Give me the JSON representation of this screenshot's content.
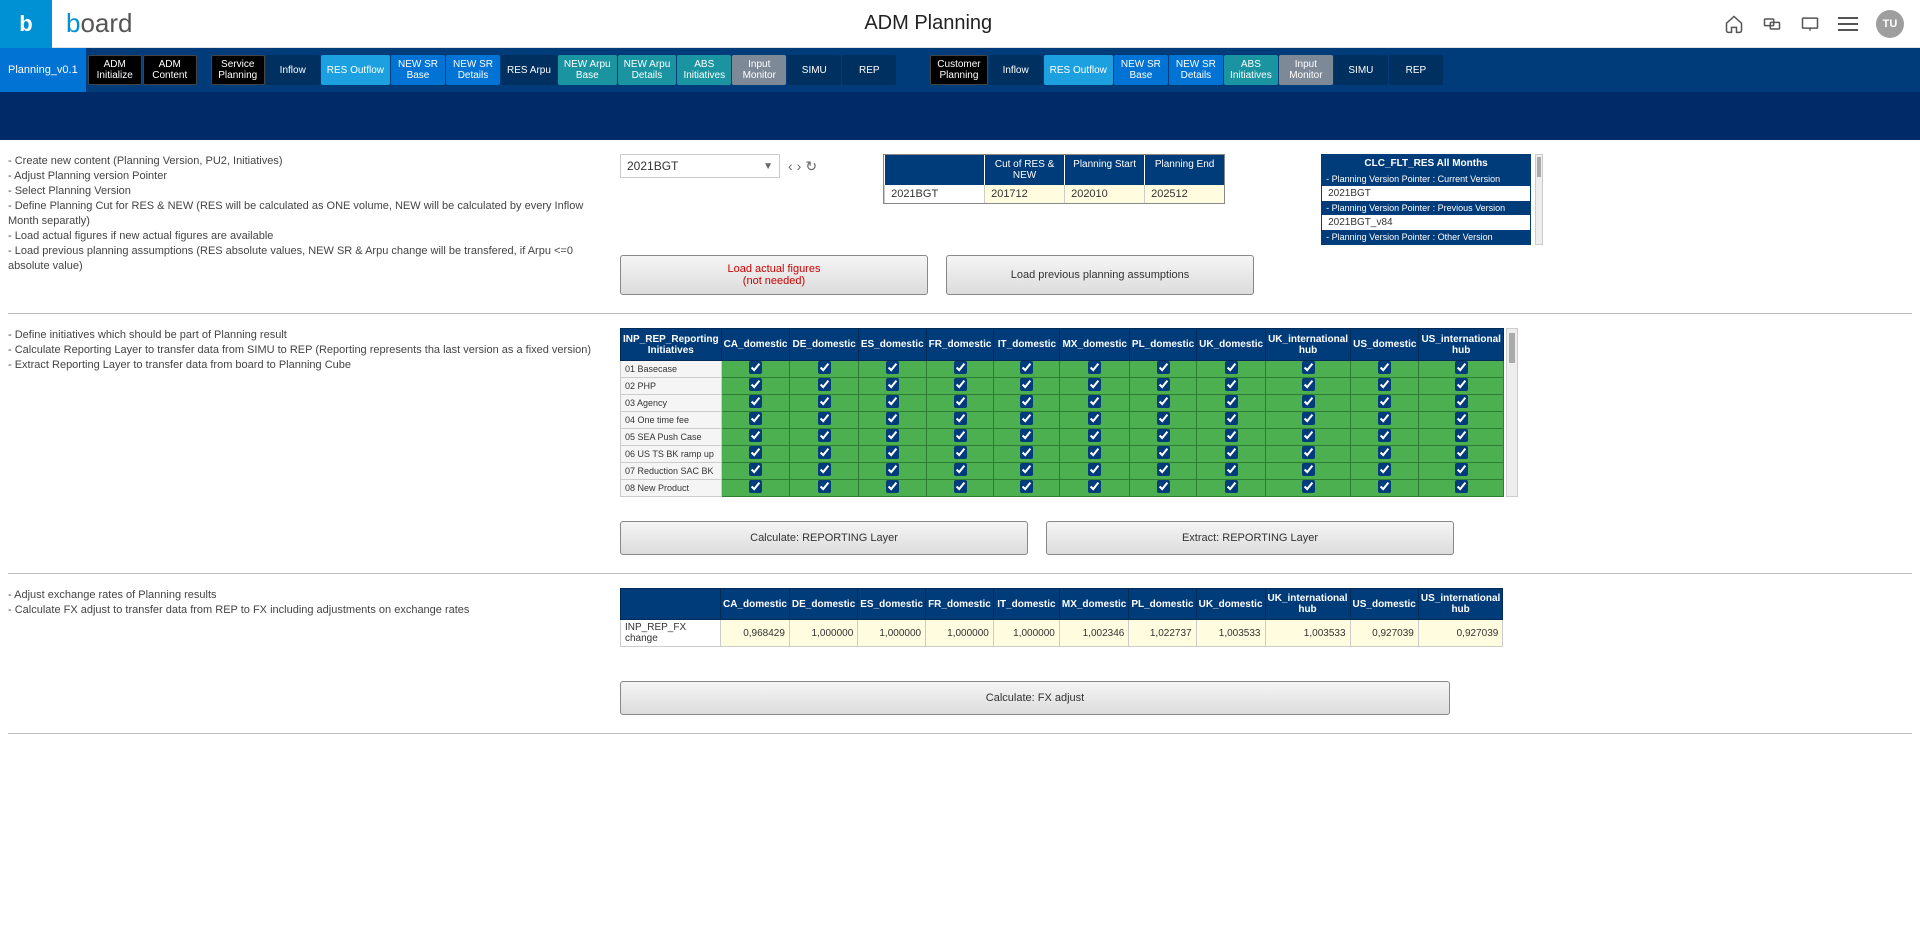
{
  "header": {
    "logo_letter": "b",
    "logo_text_html": "board",
    "page_title": "ADM Planning",
    "avatar": "TU"
  },
  "nav": {
    "left_label": "Planning_v0.1",
    "group1": [
      {
        "label": "ADM\nInitialize",
        "cls": "black"
      },
      {
        "label": "ADM\nContent",
        "cls": "black"
      }
    ],
    "group2": [
      {
        "label": "Service\nPlanning",
        "cls": "black"
      },
      {
        "label": "Inflow",
        "cls": "dark"
      },
      {
        "label": "RES Outflow",
        "cls": "light"
      },
      {
        "label": "NEW SR\nBase",
        "cls": "mid"
      },
      {
        "label": "NEW SR\nDetails",
        "cls": "mid"
      },
      {
        "label": "RES Arpu",
        "cls": "dark"
      },
      {
        "label": "NEW Arpu\nBase",
        "cls": "teal"
      },
      {
        "label": "NEW Arpu\nDetails",
        "cls": "teal"
      },
      {
        "label": "ABS\nInitiatives",
        "cls": "teal"
      },
      {
        "label": "Input\nMonitor",
        "cls": "gray"
      },
      {
        "label": "SIMU",
        "cls": "dark"
      },
      {
        "label": "REP",
        "cls": "dark"
      }
    ],
    "group3": [
      {
        "label": "Customer\nPlanning",
        "cls": "black"
      },
      {
        "label": "Inflow",
        "cls": "dark"
      },
      {
        "label": "RES Outflow",
        "cls": "light"
      },
      {
        "label": "NEW SR\nBase",
        "cls": "mid"
      },
      {
        "label": "NEW SR\nDetails",
        "cls": "mid"
      },
      {
        "label": "ABS\nInitiatives",
        "cls": "teal"
      },
      {
        "label": "Input\nMonitor",
        "cls": "gray"
      },
      {
        "label": "SIMU",
        "cls": "dark"
      },
      {
        "label": "REP",
        "cls": "dark"
      }
    ]
  },
  "section1": {
    "instructions": "- Create new content (Planning Version, PU2, Initiatives)\n- Adjust Planning version Pointer\n- Select Planning Version\n- Define Planning Cut for RES & NEW (RES will be calculated as ONE volume, NEW will be calculated by every Inflow Month separatly)\n- Load actual figures if new actual figures are available\n- Load previous planning assumptions (RES absolute values, NEW SR & Arpu change will be transfered, if Arpu <=0 absolute value)",
    "dropdown_value": "2021BGT",
    "info_table": {
      "headers": [
        "",
        "Cut of RES & NEW",
        "Planning Start",
        "Planning End"
      ],
      "row": [
        "2021BGT",
        "201712",
        "202010",
        "202512"
      ]
    },
    "clc": {
      "title": "CLC_FLT_RES All Months",
      "rows": [
        {
          "h": "- Planning Version Pointer : Current Version",
          "v": "2021BGT"
        },
        {
          "h": "- Planning Version Pointer : Previous Version",
          "v": "2021BGT_v84"
        },
        {
          "h": "- Planning Version Pointer : Other Version",
          "v": ""
        }
      ]
    },
    "btn1_line1": "Load actual figures",
    "btn1_line2": "(not needed)",
    "btn2": "Load previous planning assumptions"
  },
  "section2": {
    "instructions": "- Define initiatives which should be part of Planning result\n- Calculate Reporting Layer to transfer data from SIMU to REP (Reporting represents tha last version as a fixed version)\n- Extract Reporting Layer to transfer data from board to Planning Cube",
    "grid": {
      "corner": "INP_REP_Reporting Initiatives",
      "cols": [
        "CA_domestic",
        "DE_domestic",
        "ES_domestic",
        "FR_domestic",
        "IT_domestic",
        "MX_domestic",
        "PL_domestic",
        "UK_domestic",
        "UK_international hub",
        "US_domestic",
        "US_international hub"
      ],
      "rows": [
        "01 Basecase",
        "02 PHP",
        "03 Agency",
        "04 One time fee",
        "05 SEA Push Case",
        "06 US TS BK ramp up",
        "07 Reduction SAC BK",
        "08 New Product"
      ]
    },
    "btn_calc": "Calculate: REPORTING Layer",
    "btn_extract": "Extract: REPORTING Layer"
  },
  "section3": {
    "instructions": "- Adjust exchange rates of Planning results\n- Calculate FX adjust to transfer data from REP to FX including adjustments on exchange rates",
    "fx": {
      "cols": [
        "CA_domestic",
        "DE_domestic",
        "ES_domestic",
        "FR_domestic",
        "IT_domestic",
        "MX_domestic",
        "PL_domestic",
        "UK_domestic",
        "UK_international hub",
        "US_domestic",
        "US_international hub"
      ],
      "row_label": "INP_REP_FX change",
      "values": [
        "0,968429",
        "1,000000",
        "1,000000",
        "1,000000",
        "1,000000",
        "1,002346",
        "1,022737",
        "1,003533",
        "1,003533",
        "0,927039",
        "0,927039"
      ]
    },
    "btn": "Calculate: FX adjust"
  }
}
